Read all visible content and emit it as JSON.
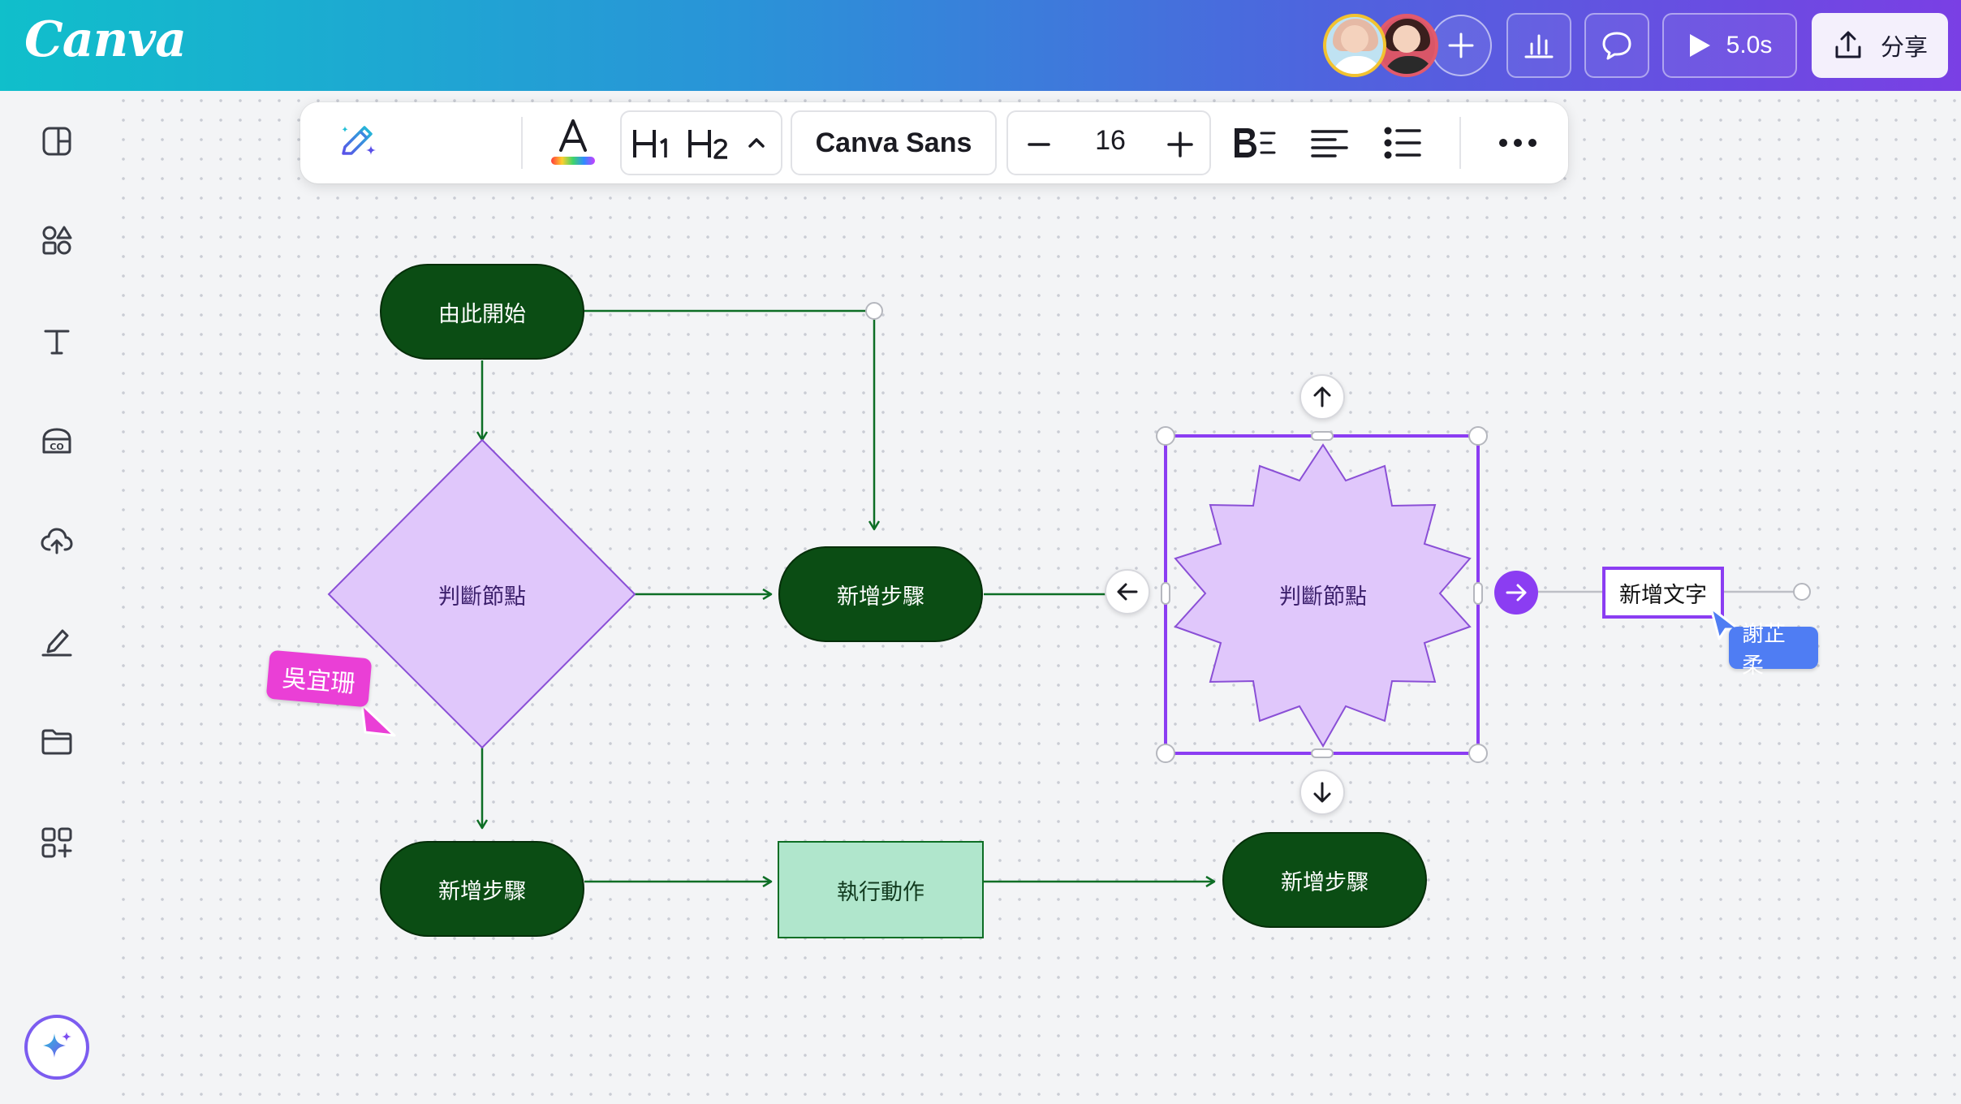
{
  "app": {
    "logo": "Canva"
  },
  "header": {
    "collaborators": [
      "avatar-1",
      "avatar-2"
    ],
    "add_collaborator_icon": "plus-icon",
    "insights_icon": "bar-chart-icon",
    "comment_icon": "comment-icon",
    "present_duration": "5.0s",
    "share_label": "分享"
  },
  "sidebar": {
    "items": [
      "design-icon",
      "elements-icon",
      "text-icon",
      "brand-icon",
      "uploads-icon",
      "draw-icon",
      "projects-icon",
      "apps-icon"
    ],
    "magic_icon": "sparkle-icon"
  },
  "toolbar": {
    "h1_label": "H1",
    "h2_label": "H2",
    "font_name": "Canva Sans",
    "font_size": "16"
  },
  "flowchart": {
    "start": "由此開始",
    "decision": "判斷節點",
    "step_top": "新增步驟",
    "step_bottom_left": "新增步驟",
    "action": "執行動作",
    "selected_shape": "判斷節點",
    "step_bottom_right": "新增步驟",
    "new_text": "新增文字"
  },
  "cursors": {
    "pink_user": "吳宜珊",
    "blue_user": "謝芷柔"
  },
  "colors": {
    "node_dark_green": "#0b4d14",
    "connector_green": "#0d6e25",
    "decision_purple": "#e0c7fb",
    "selection_purple": "#8b3df2",
    "action_mint": "#b0e6cc"
  }
}
